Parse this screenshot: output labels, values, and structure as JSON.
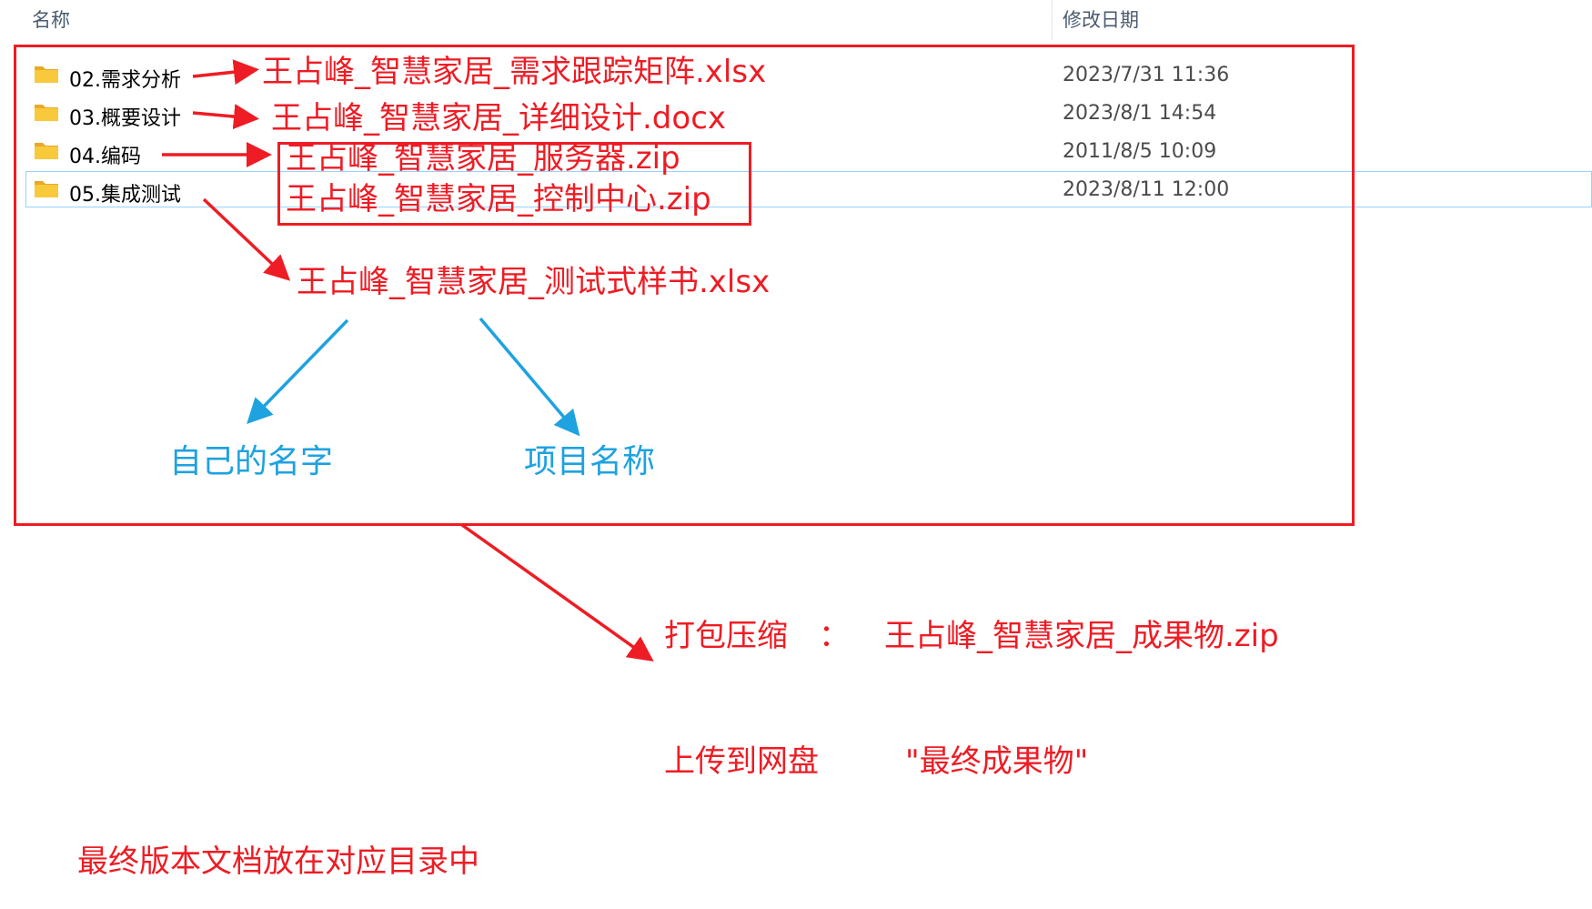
{
  "header": {
    "name_col": "名称",
    "date_col": "修改日期"
  },
  "files": [
    {
      "name": "02.需求分析",
      "date": "2023/7/31 11:36"
    },
    {
      "name": "03.概要设计",
      "date": "2023/8/1 14:54"
    },
    {
      "name": "04.编码",
      "date": "2011/8/5 10:09"
    },
    {
      "name": "05.集成测试",
      "date": "2023/8/11 12:00"
    }
  ],
  "annotations": {
    "req_file": "王占峰_智慧家居_需求跟踪矩阵.xlsx",
    "design_file": "王占峰_智慧家居_详细设计.docx",
    "code_file_1": "王占峰_智慧家居_服务器.zip",
    "code_file_2": "王占峰_智慧家居_控制中心.zip",
    "test_file": "王占峰_智慧家居_测试式样书.xlsx",
    "own_name": "自己的名字",
    "project_name": "项目名称",
    "pack_label": "打包压缩",
    "pack_colon": "：",
    "pack_file": "王占峰_智慧家居_成果物.zip",
    "upload_label": "上传到网盘",
    "upload_target": "\"最终成果物\"",
    "final_note": "最终版本文档放在对应目录中"
  },
  "colors": {
    "annotation_red": "#ee1c24",
    "annotation_blue": "#1ea2e0",
    "folder_yellow": "#f8c93b"
  }
}
